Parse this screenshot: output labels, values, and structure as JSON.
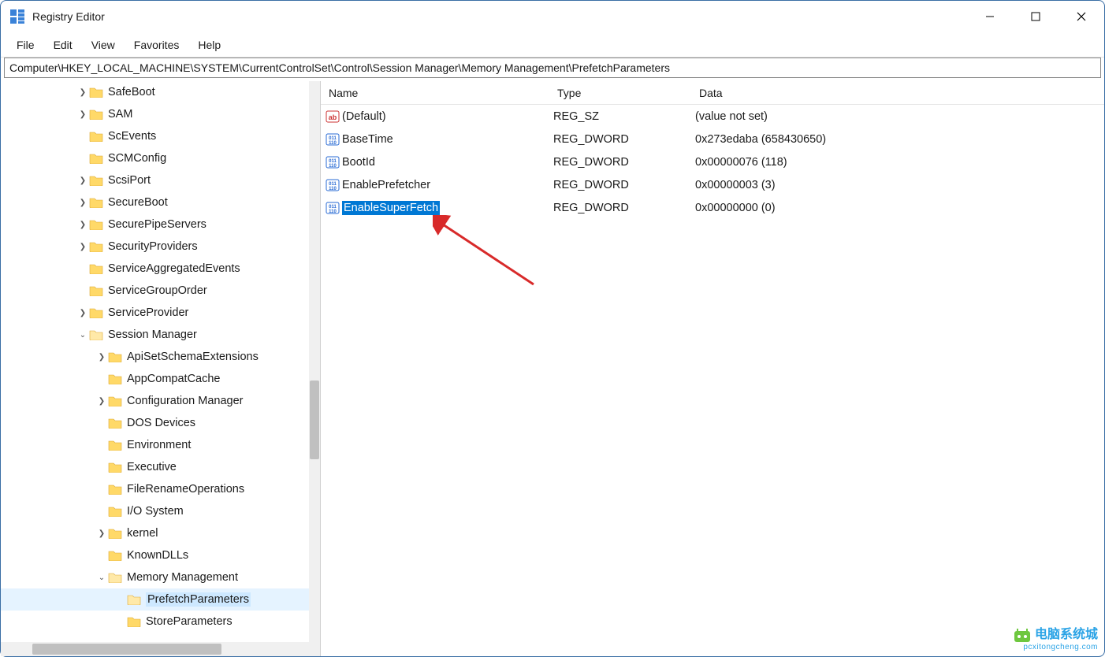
{
  "titlebar": {
    "title": "Registry Editor"
  },
  "menu": {
    "file": "File",
    "edit": "Edit",
    "view": "View",
    "favorites": "Favorites",
    "help": "Help"
  },
  "address": "Computer\\HKEY_LOCAL_MACHINE\\SYSTEM\\CurrentControlSet\\Control\\Session Manager\\Memory Management\\PrefetchParameters",
  "columns": {
    "name": "Name",
    "type": "Type",
    "data": "Data"
  },
  "tree": [
    {
      "indent": 96,
      "chev": ">",
      "label": "SafeBoot"
    },
    {
      "indent": 96,
      "chev": ">",
      "label": "SAM"
    },
    {
      "indent": 96,
      "chev": "",
      "label": "ScEvents"
    },
    {
      "indent": 96,
      "chev": "",
      "label": "SCMConfig"
    },
    {
      "indent": 96,
      "chev": ">",
      "label": "ScsiPort"
    },
    {
      "indent": 96,
      "chev": ">",
      "label": "SecureBoot"
    },
    {
      "indent": 96,
      "chev": ">",
      "label": "SecurePipeServers"
    },
    {
      "indent": 96,
      "chev": ">",
      "label": "SecurityProviders"
    },
    {
      "indent": 96,
      "chev": "",
      "label": "ServiceAggregatedEvents"
    },
    {
      "indent": 96,
      "chev": "",
      "label": "ServiceGroupOrder"
    },
    {
      "indent": 96,
      "chev": ">",
      "label": "ServiceProvider"
    },
    {
      "indent": 96,
      "chev": "v",
      "label": "Session Manager"
    },
    {
      "indent": 120,
      "chev": ">",
      "label": "ApiSetSchemaExtensions"
    },
    {
      "indent": 120,
      "chev": "",
      "label": "AppCompatCache"
    },
    {
      "indent": 120,
      "chev": ">",
      "label": "Configuration Manager"
    },
    {
      "indent": 120,
      "chev": "",
      "label": "DOS Devices"
    },
    {
      "indent": 120,
      "chev": "",
      "label": "Environment"
    },
    {
      "indent": 120,
      "chev": "",
      "label": "Executive"
    },
    {
      "indent": 120,
      "chev": "",
      "label": "FileRenameOperations"
    },
    {
      "indent": 120,
      "chev": "",
      "label": "I/O System"
    },
    {
      "indent": 120,
      "chev": ">",
      "label": "kernel"
    },
    {
      "indent": 120,
      "chev": "",
      "label": "KnownDLLs"
    },
    {
      "indent": 120,
      "chev": "v",
      "label": "Memory Management"
    },
    {
      "indent": 144,
      "chev": "",
      "label": "PrefetchParameters",
      "selected": true
    },
    {
      "indent": 144,
      "chev": "",
      "label": "StoreParameters"
    }
  ],
  "values": [
    {
      "icon": "sz",
      "name": "(Default)",
      "type": "REG_SZ",
      "data": "(value not set)"
    },
    {
      "icon": "dword",
      "name": "BaseTime",
      "type": "REG_DWORD",
      "data": "0x273edaba (658430650)"
    },
    {
      "icon": "dword",
      "name": "BootId",
      "type": "REG_DWORD",
      "data": "0x00000076 (118)"
    },
    {
      "icon": "dword",
      "name": "EnablePrefetcher",
      "type": "REG_DWORD",
      "data": "0x00000003 (3)"
    },
    {
      "icon": "dword",
      "name": "EnableSuperFetch",
      "type": "REG_DWORD",
      "data": "0x00000000 (0)",
      "selected": true
    }
  ],
  "watermark": {
    "brand": "电脑系统城",
    "url": "pcxitongcheng.com"
  }
}
